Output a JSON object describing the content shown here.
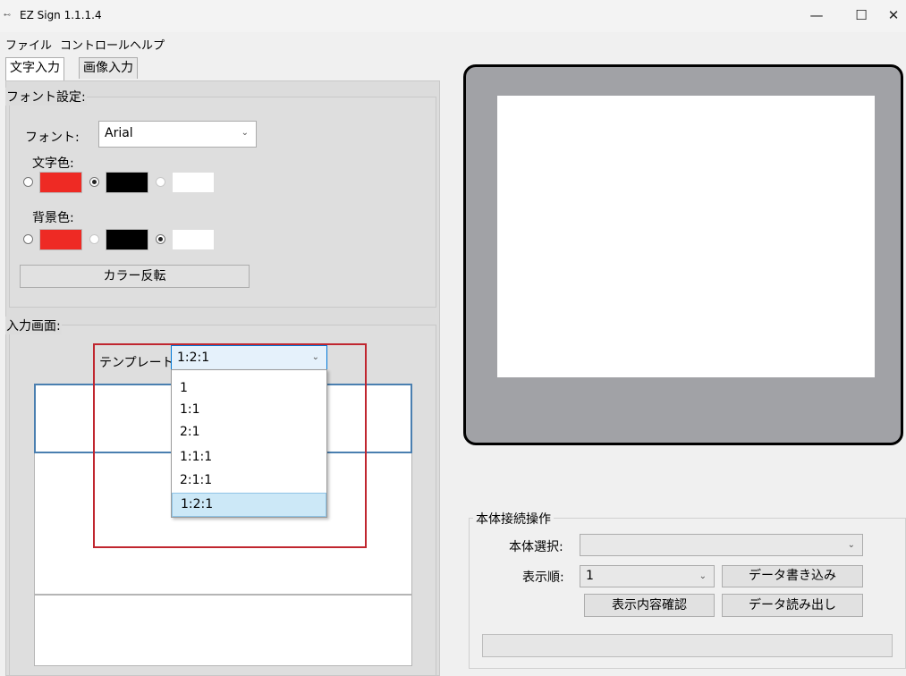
{
  "window": {
    "title": "EZ Sign 1.1.1.4",
    "icon": "app-icon",
    "controls": [
      "—",
      "☐",
      "✕"
    ]
  },
  "menu": [
    "ファイル",
    "コントロール",
    "ヘルプ"
  ],
  "tabs": [
    {
      "label": "文字入力",
      "active": true
    },
    {
      "label": "画像入力",
      "active": false
    }
  ],
  "font_settings": {
    "legend": "フォント設定:",
    "font_label": "フォント:",
    "font_value": "Arial",
    "text_color_label": "文字色:",
    "bg_color_label": "背景色:",
    "text_color_selected": "black",
    "bg_color_selected": "white",
    "colors": [
      "#ee2a24",
      "#000000",
      "#ffffff"
    ],
    "invert_button": "カラー反転"
  },
  "input_screen": {
    "legend": "入力画面:",
    "template_label": "テンプレート:",
    "template_value": "1:2:1",
    "template_options": [
      "1",
      "1:1",
      "2:1",
      "1:1:1",
      "2:1:1",
      "1:2:1"
    ],
    "selected_option": "1:2:1"
  },
  "connection": {
    "legend": "本体接続操作",
    "device_label": "本体選択:",
    "device_value": "",
    "order_label": "表示順:",
    "order_value": "1",
    "write_button": "データ書き込み",
    "confirm_button": "表示内容確認",
    "read_button": "データ読み出し"
  },
  "accent_colors": {
    "highlight_box": "#c0262f",
    "selection": "#cce8f7",
    "preview_frame": "#a1a2a6"
  }
}
